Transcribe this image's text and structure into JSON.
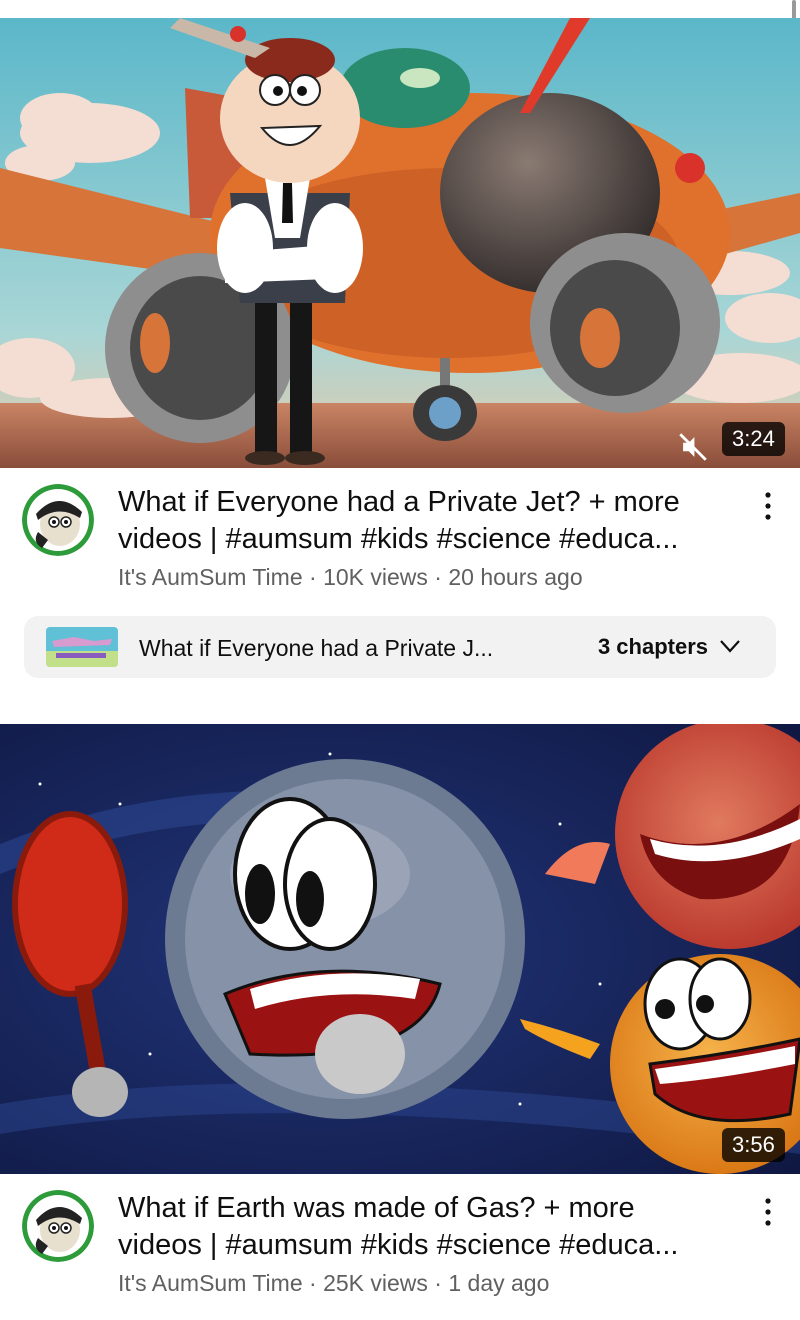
{
  "videos": [
    {
      "duration": "3:24",
      "title_line1": "What if Everyone had a Private Jet? + more",
      "title_line2": "videos | #aumsum #kids #science #educa...",
      "channel": "It's AumSum Time",
      "views": "10K views",
      "age": "20 hours ago",
      "separator": "·",
      "chapters": {
        "title": "What if Everyone had a Private J...",
        "count_label": "3 chapters"
      }
    },
    {
      "duration": "3:56",
      "title_line1": "What if Earth was made of Gas? + more",
      "title_line2": "videos | #aumsum #kids #science #educa...",
      "channel": "It's AumSum Time",
      "views": "25K views",
      "age": "1 day ago",
      "separator": "·"
    }
  ],
  "icons": {
    "muted": "volume-off-icon",
    "more": "more-vert-icon",
    "chevron": "chevron-down-icon"
  },
  "colors": {
    "text_primary": "#0f0f0f",
    "text_secondary": "#606060",
    "chapter_bg": "#f2f2f2",
    "duration_bg": "#000000"
  }
}
